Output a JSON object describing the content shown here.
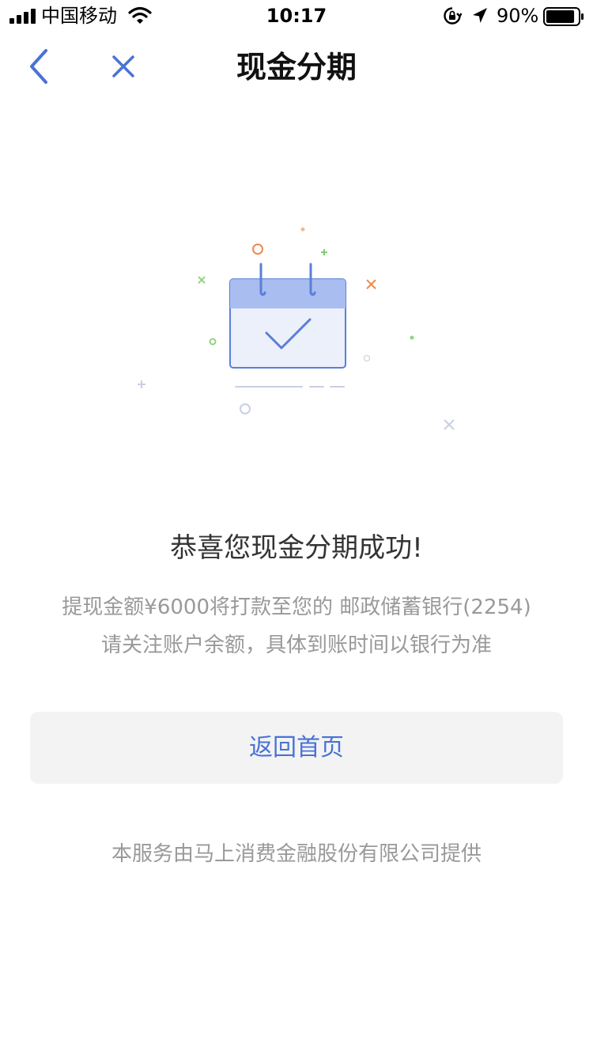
{
  "status_bar": {
    "carrier": "中国移动",
    "time": "10:17",
    "battery_percent": "90%",
    "battery_level": 0.9,
    "icons": [
      "signal-icon",
      "wifi-icon",
      "orientation-lock-icon",
      "location-arrow-icon",
      "battery-icon"
    ]
  },
  "nav": {
    "title": "现金分期",
    "back_icon": "chevron-left-icon",
    "close_icon": "close-icon"
  },
  "illustration": {
    "icon": "calendar-check-icon"
  },
  "result": {
    "title": "恭喜您现金分期成功!",
    "line1": "提现金额¥6000将打款至您的 邮政储蓄银行(2254)",
    "line2": "请关注账户余额，具体到账时间以银行为准"
  },
  "actions": {
    "home_label": "返回首页"
  },
  "footer": {
    "provider": "本服务由马上消费金融股份有限公司提供"
  },
  "colors": {
    "accent": "#4a72d6",
    "text_primary": "#333333",
    "text_secondary": "#999999",
    "button_bg": "#f3f3f3"
  }
}
